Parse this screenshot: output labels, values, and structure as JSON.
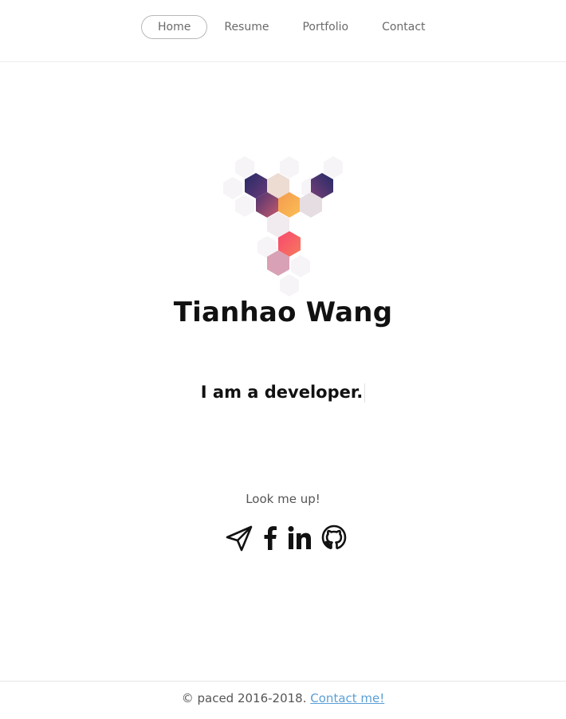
{
  "nav": {
    "items": [
      {
        "label": "Home",
        "active": true
      },
      {
        "label": "Resume",
        "active": false
      },
      {
        "label": "Portfolio",
        "active": false
      },
      {
        "label": "Contact",
        "active": false
      }
    ]
  },
  "hero": {
    "name": "Tianhao Wang",
    "tagline": "I am a developer."
  },
  "social": {
    "prompt": "Look me up!",
    "icons": [
      "paper-plane-icon",
      "facebook-icon",
      "linkedin-icon",
      "github-icon"
    ]
  },
  "footer": {
    "copyright": "© paced 2016-2018.",
    "link_label": "Contact me!"
  },
  "colors": {
    "accent_link": "#5a9fd6",
    "logo_navy": "#2d2a63",
    "logo_orange": "#f6a84b",
    "logo_red": "#f4566b",
    "logo_pink": "#d8a2b6"
  }
}
